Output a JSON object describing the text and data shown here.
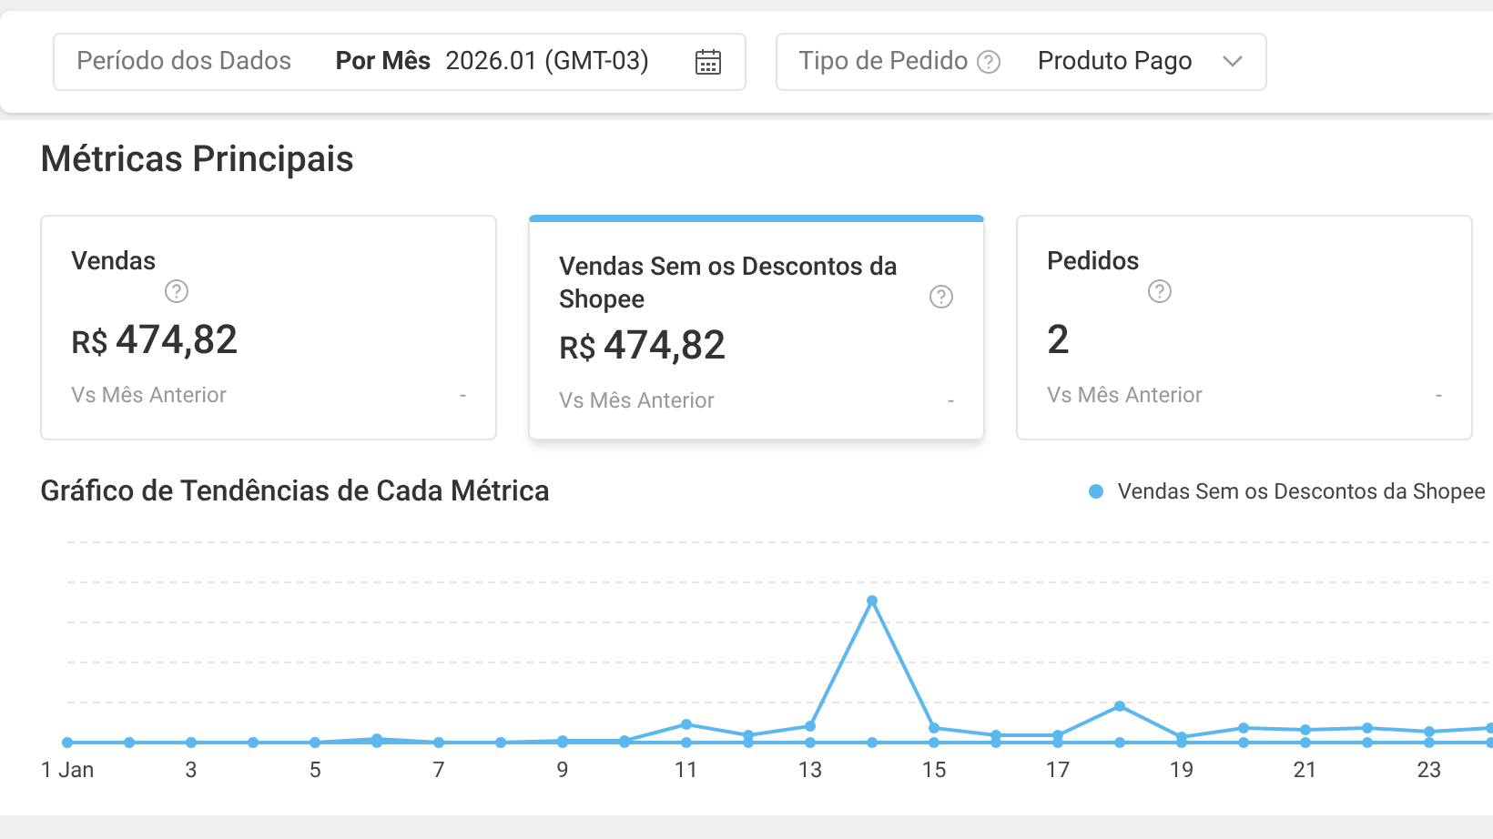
{
  "filters": [
    {
      "kind": "date",
      "label": "Período dos Dados",
      "mode": "Por Mês",
      "value": "2026.01 (GMT-03)"
    },
    {
      "kind": "select",
      "label": "Tipo de Pedido",
      "value": "Produto Pago"
    }
  ],
  "metrics_title": "Métricas Principais",
  "metrics": [
    {
      "name": "Vendas",
      "value": "474,82",
      "currency": "R$",
      "compare_label": "Vs Mês Anterior",
      "compare_value": "-",
      "selected": false
    },
    {
      "name": "Vendas Sem os Descontos da Shopee",
      "value": "474,82",
      "currency": "R$",
      "compare_label": "Vs Mês Anterior",
      "compare_value": "-",
      "selected": true
    },
    {
      "name": "Pedidos",
      "value": "2",
      "compare_label": "Vs Mês Anterior",
      "compare_value": "-",
      "selected": false
    }
  ],
  "chart": {
    "title": "Gráfico de Tendências de Cada Métrica",
    "legend": [
      {
        "name": "Vendas Sem os Descontos da Shopee",
        "color": "#5bb8ee"
      }
    ],
    "x_labels": [
      "1 Jan",
      "3",
      "5",
      "7",
      "9",
      "11",
      "13",
      "15",
      "17",
      "19",
      "21",
      "23"
    ]
  }
}
